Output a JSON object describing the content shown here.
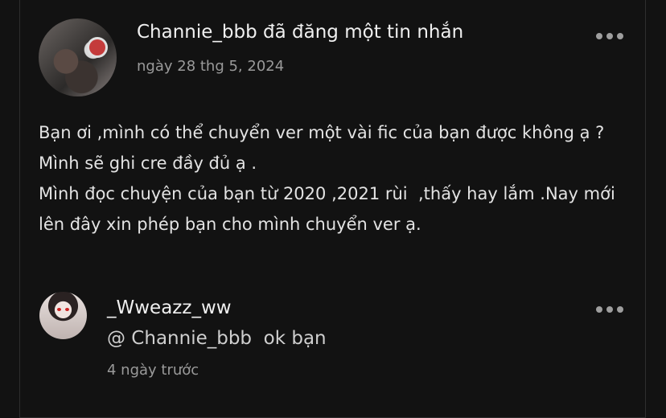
{
  "post": {
    "title": "Channie_bbb đã đăng một tin nhắn",
    "date": "ngày 28 thg 5, 2024",
    "avatar_icon": "user-avatar",
    "more_icon": "more-horizontal-icon",
    "message_lines": [
      "Bạn ơi ,mình có thể chuyển ver một vài fic của bạn được không ạ ? Mình sẽ ghi cre đầy đủ ạ .",
      "Mình đọc chuyện của bạn từ 2020 ,2021 rùi  ,thấy hay lắm .Nay mới lên đây xin phép bạn cho mình chuyển ver ạ."
    ]
  },
  "reply": {
    "username": "_Wweazz_ww",
    "text": "@ Channie_bbb  ok bạn",
    "time": "4 ngày trước",
    "avatar_icon": "user-avatar",
    "more_icon": "more-horizontal-icon"
  }
}
